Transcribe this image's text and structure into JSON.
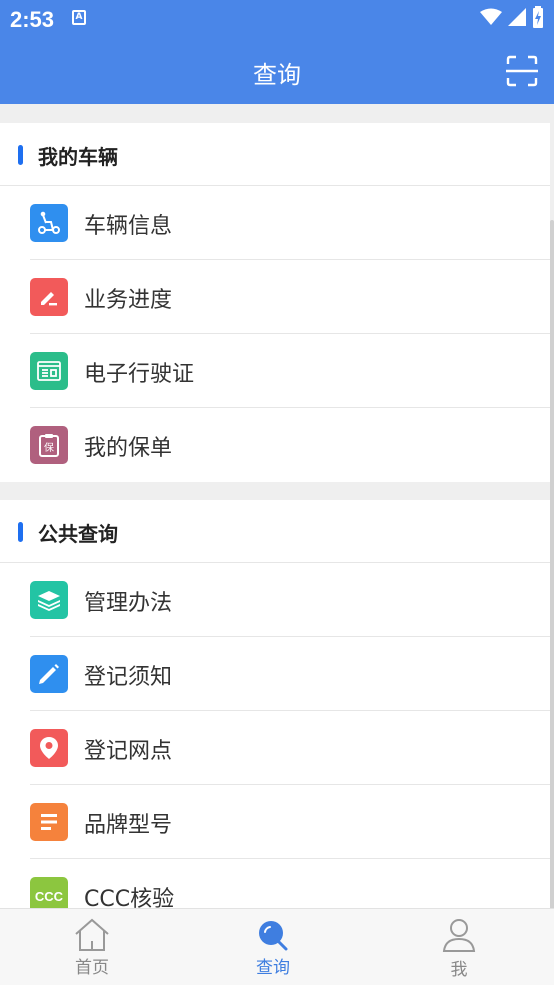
{
  "status_bar": {
    "time": "2:53",
    "notification_icon": "a-icon"
  },
  "header": {
    "title": "查询",
    "scan_icon": "scan-icon"
  },
  "sections": [
    {
      "title": "我的车辆",
      "items": [
        {
          "label": "车辆信息",
          "icon": "scooter-icon",
          "color": "#2f8fef"
        },
        {
          "label": "业务进度",
          "icon": "edit-icon",
          "color": "#f25a5a"
        },
        {
          "label": "电子行驶证",
          "icon": "license-icon",
          "color": "#2bbd8a"
        },
        {
          "label": "我的保单",
          "icon": "insurance-icon",
          "color": "#b0607e"
        }
      ]
    },
    {
      "title": "公共查询",
      "items": [
        {
          "label": "管理办法",
          "icon": "layers-icon",
          "color": "#23c4a4"
        },
        {
          "label": "登记须知",
          "icon": "pencil-icon",
          "color": "#2f8fef"
        },
        {
          "label": "登记网点",
          "icon": "location-pin-icon",
          "color": "#f25a5a"
        },
        {
          "label": "品牌型号",
          "icon": "list-icon",
          "color": "#f5823c"
        },
        {
          "label": "CCC核验",
          "icon": "ccc-icon",
          "icon_text": "CCC",
          "color": "#8cc63f"
        }
      ]
    }
  ],
  "tabs": [
    {
      "label": "首页",
      "icon": "home-icon",
      "active": false
    },
    {
      "label": "查询",
      "icon": "search-icon",
      "active": true
    },
    {
      "label": "我",
      "icon": "user-icon",
      "active": false
    }
  ]
}
